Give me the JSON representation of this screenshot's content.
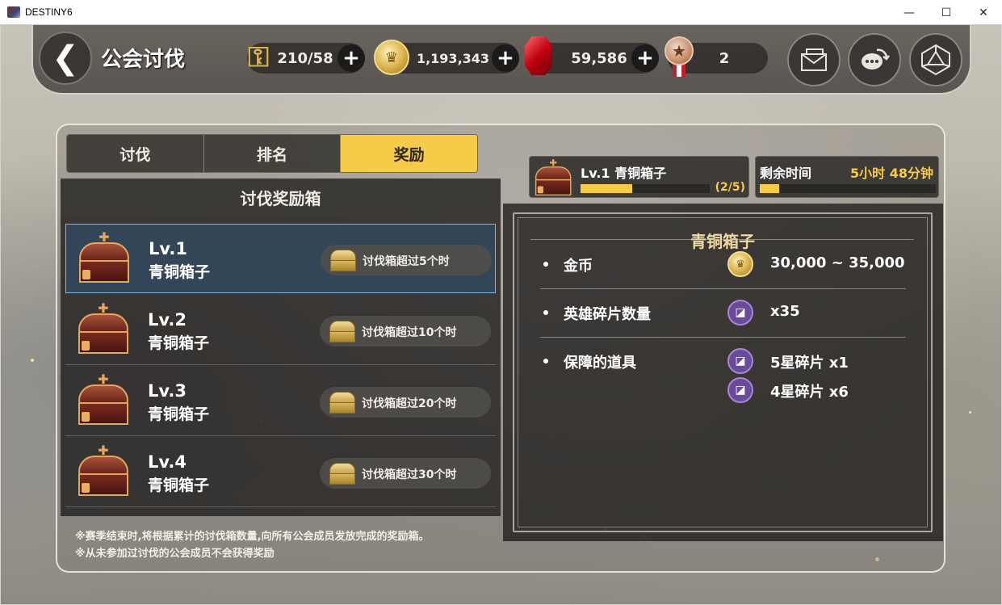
{
  "window": {
    "title": "DESTINY6",
    "minimize": "—",
    "maximize": "☐",
    "close": "✕"
  },
  "header": {
    "back_glyph": "❮",
    "title": "公会讨伐",
    "resources": [
      {
        "icon": "key-icon",
        "value": "210/58",
        "has_plus": true
      },
      {
        "icon": "gold-coin-icon",
        "value": "1,193,343",
        "has_plus": true
      },
      {
        "icon": "red-gem-icon",
        "value": "59,586",
        "has_plus": true
      },
      {
        "icon": "medal-icon",
        "value": "2",
        "has_plus": false
      }
    ],
    "plus_glyph": "+",
    "buttons": [
      "mail-icon",
      "chat-icon",
      "dice-icon"
    ]
  },
  "tabs": [
    {
      "label": "讨伐",
      "active": false
    },
    {
      "label": "排名",
      "active": false
    },
    {
      "label": "奖励",
      "active": true
    }
  ],
  "reward_list": {
    "header": "讨伐奖励箱",
    "items": [
      {
        "level": "Lv.1",
        "name": "青铜箱子",
        "condition": "讨伐箱超过5个时",
        "selected": true
      },
      {
        "level": "Lv.2",
        "name": "青铜箱子",
        "condition": "讨伐箱超过10个时",
        "selected": false
      },
      {
        "level": "Lv.3",
        "name": "青铜箱子",
        "condition": "讨伐箱超过20个时",
        "selected": false
      },
      {
        "level": "Lv.4",
        "name": "青铜箱子",
        "condition": "讨伐箱超过30个时",
        "selected": false
      }
    ]
  },
  "progress": {
    "box_title": "Lv.1 青铜箱子",
    "box_count": "(2/5)",
    "box_fraction": 0.4,
    "remaining_label": "剩余时间",
    "remaining_value": "5小时 48分钟",
    "remaining_fraction": 0.11
  },
  "detail": {
    "title": "青铜箱子",
    "rows": [
      {
        "label": "金币",
        "icon": "gold-coin-icon",
        "value": "30,000 ~ 35,000"
      },
      {
        "label": "英雄碎片数量",
        "icon": "hero-shard-icon",
        "value": "x35"
      },
      {
        "label": "保障的道具",
        "icon": "hero-shard-icon",
        "value": "5星碎片 x1"
      },
      {
        "label": "",
        "icon": "hero-shard-icon",
        "value": "4星碎片 x6"
      }
    ]
  },
  "footnotes": [
    "※赛季结束时,将根据累计的讨伐箱数量,向所有公会成员发放完成的奖励箱。",
    "※从未参加过讨伐的公会成员不会获得奖励"
  ],
  "colors": {
    "accent": "#f6cb48",
    "selected_border": "#7ab6e0",
    "detail_title": "#f0d9a0"
  }
}
